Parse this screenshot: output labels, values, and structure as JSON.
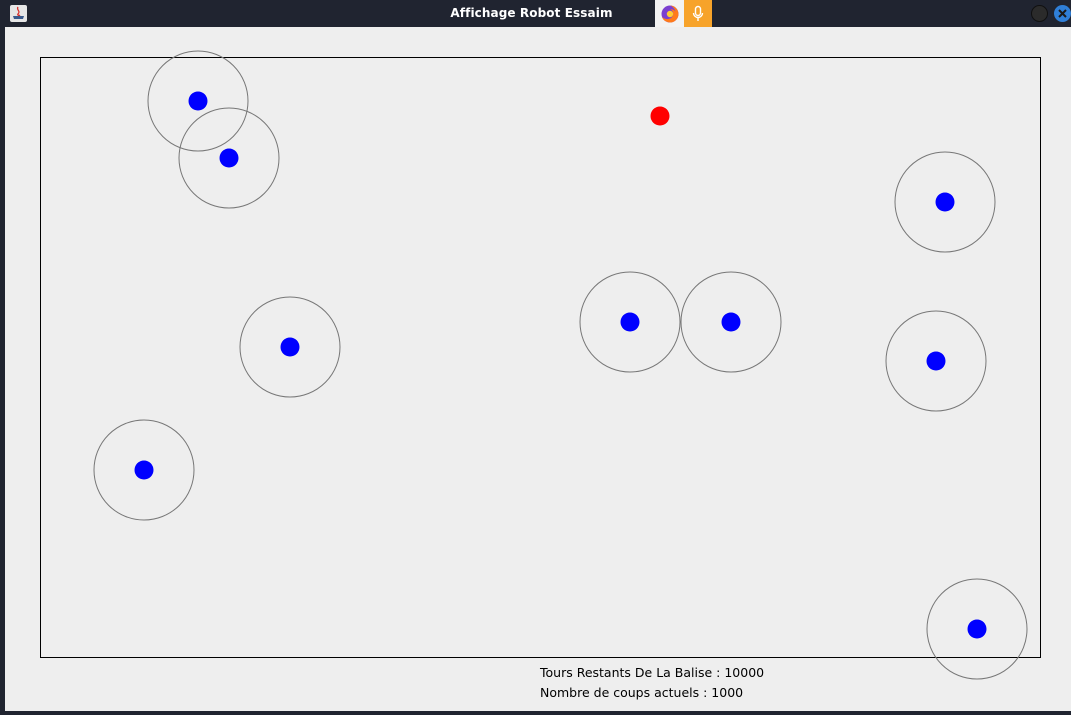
{
  "window": {
    "title": "Affichage Robot Essaim"
  },
  "tray": {
    "icons": [
      "firefox-icon",
      "microphone-icon"
    ],
    "accent": "#f7a32a"
  },
  "colors": {
    "robot": "#0000ff",
    "beacon": "#ff0000",
    "range_ring": "#777777",
    "background": "#eeeeee",
    "titlebar": "#202430"
  },
  "status": {
    "beacon_turns_label": "Tours Restants De La Balise : 10000",
    "moves_label": "Nombre de coups actuels : 1000"
  }
}
